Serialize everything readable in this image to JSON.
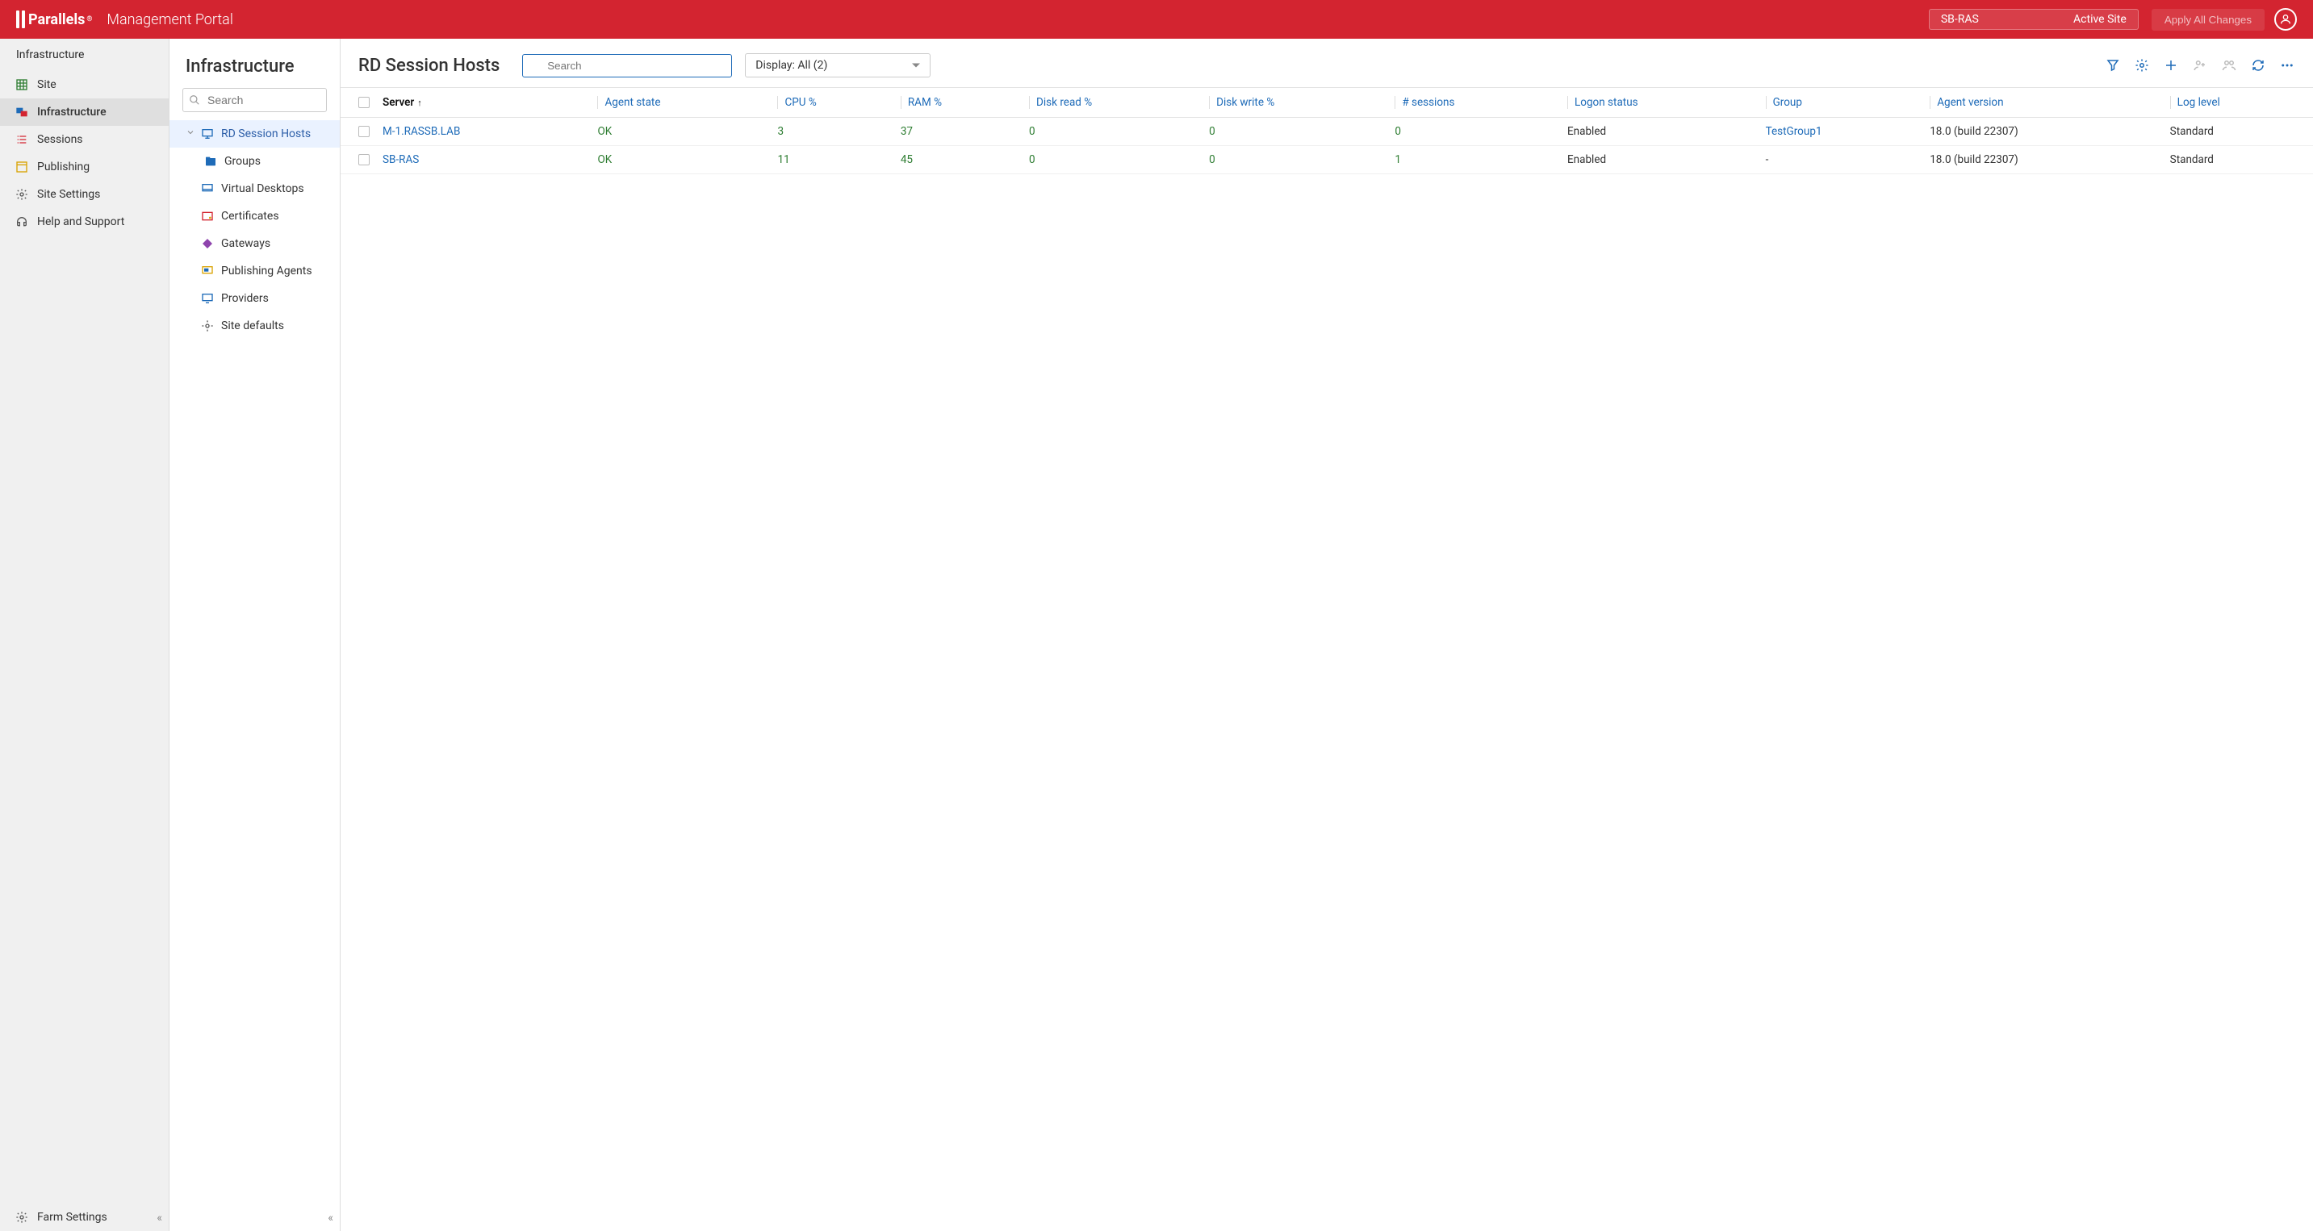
{
  "header": {
    "brand": "Parallels",
    "portal_title": "Management Portal",
    "site_name": "SB-RAS",
    "site_status": "Active Site",
    "apply_label": "Apply All Changes"
  },
  "sidebar": {
    "breadcrumb": "Infrastructure",
    "items": [
      {
        "label": "Site"
      },
      {
        "label": "Infrastructure"
      },
      {
        "label": "Sessions"
      },
      {
        "label": "Publishing"
      },
      {
        "label": "Site Settings"
      },
      {
        "label": "Help and Support"
      }
    ],
    "bottom": {
      "label": "Farm Settings"
    }
  },
  "midpanel": {
    "title": "Infrastructure",
    "search_placeholder": "Search",
    "tree": [
      {
        "label": "RD Session Hosts",
        "children": [
          {
            "label": "Groups"
          }
        ]
      },
      {
        "label": "Virtual Desktops"
      },
      {
        "label": "Certificates"
      },
      {
        "label": "Gateways"
      },
      {
        "label": "Publishing Agents"
      },
      {
        "label": "Providers"
      },
      {
        "label": "Site defaults"
      }
    ]
  },
  "content": {
    "title": "RD Session Hosts",
    "search_placeholder": "Search",
    "display_label": "Display: All (2)",
    "columns": [
      "Server",
      "Agent state",
      "CPU %",
      "RAM %",
      "Disk read %",
      "Disk write %",
      "# sessions",
      "Logon status",
      "Group",
      "Agent version",
      "Log level"
    ],
    "rows": [
      {
        "server": "M-1.RASSB.LAB",
        "agent_state": "OK",
        "cpu": "3",
        "ram": "37",
        "disk_read": "0",
        "disk_write": "0",
        "sessions": "0",
        "logon": "Enabled",
        "group": "TestGroup1",
        "agent_version": "18.0 (build 22307)",
        "log_level": "Standard"
      },
      {
        "server": "SB-RAS",
        "agent_state": "OK",
        "cpu": "11",
        "ram": "45",
        "disk_read": "0",
        "disk_write": "0",
        "sessions": "1",
        "logon": "Enabled",
        "group": "-",
        "agent_version": "18.0 (build 22307)",
        "log_level": "Standard"
      }
    ]
  }
}
